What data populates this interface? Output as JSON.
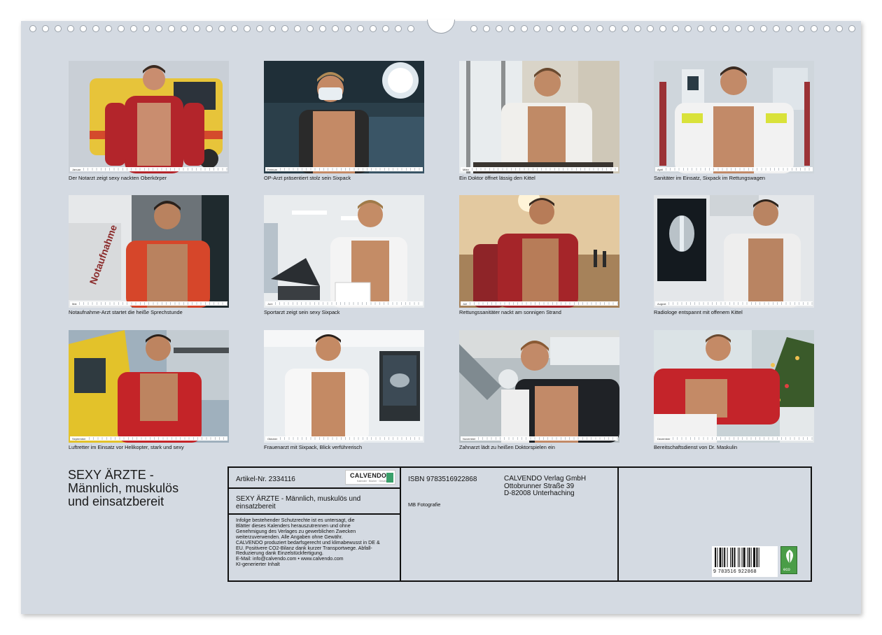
{
  "calendar": {
    "months": [
      {
        "label": "Januar",
        "caption": "Der Notarzt zeigt sexy nackten Oberkörper"
      },
      {
        "label": "Februar",
        "caption": "OP-Arzt präsentiert stolz sein Sixpack"
      },
      {
        "label": "März",
        "caption": "Ein Doktor öffnet lässig den Kittel"
      },
      {
        "label": "April",
        "caption": "Sanitäter im Einsatz, Sixpack im Rettungswagen"
      },
      {
        "label": "Mai",
        "caption": "Notaufnahme-Arzt startet die heiße Sprechstunde"
      },
      {
        "label": "Juni",
        "caption": "Sportarzt zeigt sein sexy Sixpack"
      },
      {
        "label": "Juli",
        "caption": "Rettungssanitäter nackt am sonnigen Strand"
      },
      {
        "label": "August",
        "caption": "Radiologe entspannt mit offenem Kittel"
      },
      {
        "label": "September",
        "caption": "Luftretter im Einsatz vor Helikopter, stark und sexy"
      },
      {
        "label": "Oktober",
        "caption": "Frauenarzt mit Sixpack, Blick verführerisch"
      },
      {
        "label": "November",
        "caption": "Zahnarzt lädt zu heißen Doktorspielen ein"
      },
      {
        "label": "Dezember",
        "caption": "Bereitschaftsdienst von Dr. Maskulin"
      }
    ],
    "photo_scene_text": {
      "notaufnahme_sign": "Notaufnahme"
    }
  },
  "title": {
    "lines": [
      "SEXY ÄRZTE -",
      "Männlich, muskulös",
      "und einsatzbereit"
    ]
  },
  "info": {
    "article": "Artikel-Nr. 2334116",
    "logo_word": "CALVENDO",
    "logo_sub": "Kalender · Bücher · Geschenke",
    "product_title": "SEXY ÄRZTE - Männlich, muskulös und einsatzbereit",
    "legal": [
      "Infolge bestehender Schutzrechte ist es untersagt, die",
      "Blätter dieses Kalenders herauszutrennen und ohne",
      "Genehmigung des Verlages zu gewerblichen Zwecken",
      "weiterzuverwenden. Alle Angaben ohne Gewähr.",
      "CALVENDO produziert bedarfsgerecht und klimabewusst in DE &",
      "EU. Positivere CO2-Bilanz dank kurzer Transportwege. Abfall-",
      "Reduzierung dank Einzelstückfertigung.",
      "E-Mail: info@calvendo.com • www.calvendo.com",
      "KI-generierter Inhalt"
    ],
    "isbn": "ISBN 9783516922868",
    "publisher": [
      "CALVENDO Verlag GmbH",
      "Ottobrunner Straße 39",
      "D-82008 Unterhaching"
    ],
    "photographer": "MB Fotografie",
    "ean_text": "9 783516 922868",
    "eco_label": "eco"
  },
  "colors": {
    "sheet": "#d4dae2",
    "border": "#111111",
    "eco_green": "#4a9d47"
  }
}
